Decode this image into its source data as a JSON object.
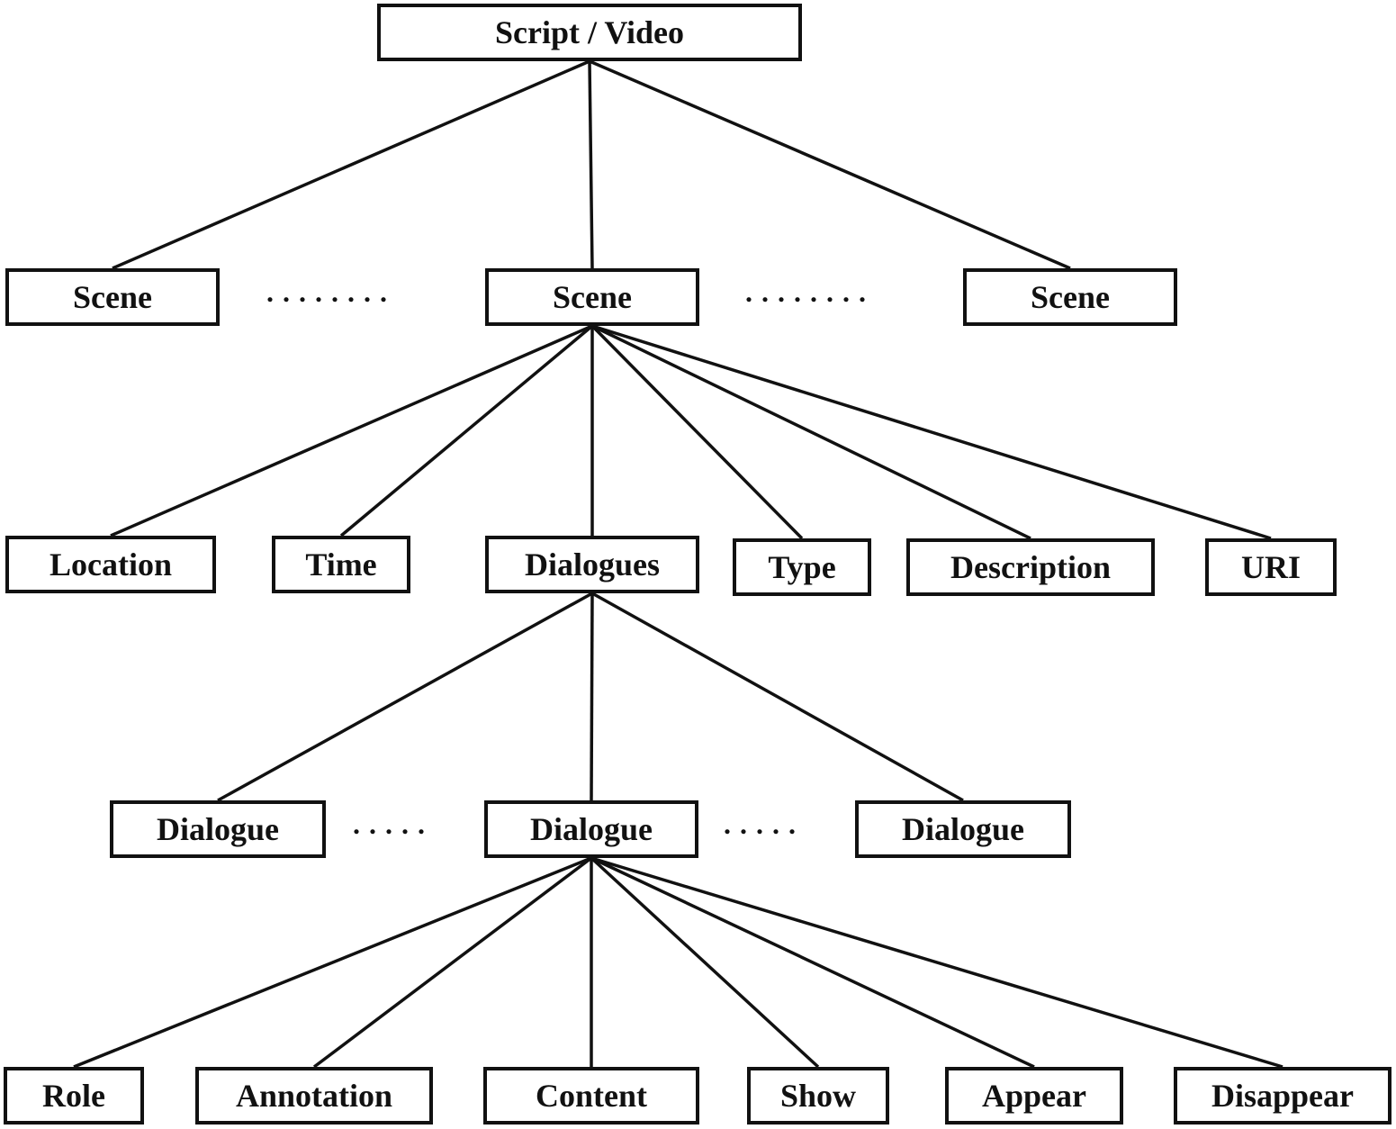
{
  "diagram": {
    "title": "",
    "nodes": {
      "root": {
        "label": "Script / Video"
      },
      "scene_left": {
        "label": "Scene"
      },
      "scene_mid": {
        "label": "Scene"
      },
      "scene_right": {
        "label": "Scene"
      },
      "location": {
        "label": "Location"
      },
      "time": {
        "label": "Time"
      },
      "dialogues": {
        "label": "Dialogues"
      },
      "type": {
        "label": "Type"
      },
      "description": {
        "label": "Description"
      },
      "uri": {
        "label": "URI"
      },
      "dialogue_left": {
        "label": "Dialogue"
      },
      "dialogue_mid": {
        "label": "Dialogue"
      },
      "dialogue_right": {
        "label": "Dialogue"
      },
      "role": {
        "label": "Role"
      },
      "annotation": {
        "label": "Annotation"
      },
      "content": {
        "label": "Content"
      },
      "show": {
        "label": "Show"
      },
      "appear": {
        "label": "Appear"
      },
      "disappear": {
        "label": "Disappear"
      }
    },
    "ellipses": {
      "scene_gap_left": "........",
      "scene_gap_right": "........",
      "dialogue_gap_left": ".....",
      "dialogue_gap_right": "....."
    },
    "edges": [
      [
        "root",
        "scene_left"
      ],
      [
        "root",
        "scene_mid"
      ],
      [
        "root",
        "scene_right"
      ],
      [
        "scene_mid",
        "location"
      ],
      [
        "scene_mid",
        "time"
      ],
      [
        "scene_mid",
        "dialogues"
      ],
      [
        "scene_mid",
        "type"
      ],
      [
        "scene_mid",
        "description"
      ],
      [
        "scene_mid",
        "uri"
      ],
      [
        "dialogues",
        "dialogue_left"
      ],
      [
        "dialogues",
        "dialogue_mid"
      ],
      [
        "dialogues",
        "dialogue_right"
      ],
      [
        "dialogue_mid",
        "role"
      ],
      [
        "dialogue_mid",
        "annotation"
      ],
      [
        "dialogue_mid",
        "content"
      ],
      [
        "dialogue_mid",
        "show"
      ],
      [
        "dialogue_mid",
        "appear"
      ],
      [
        "dialogue_mid",
        "disappear"
      ]
    ]
  }
}
